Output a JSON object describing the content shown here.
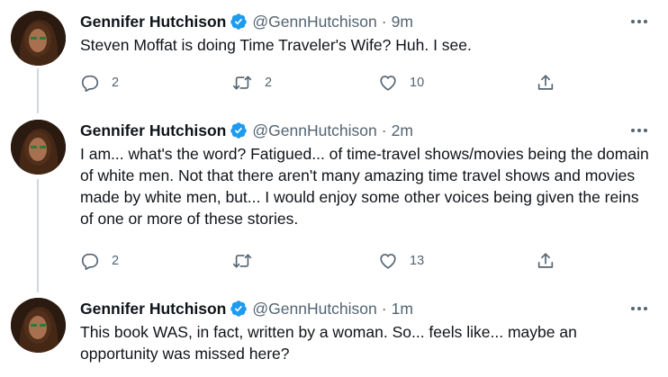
{
  "tweets": [
    {
      "name": "Gennifer Hutchison",
      "handle": "@GennHutchison",
      "separator": "·",
      "time": "9m",
      "text": "Steven Moffat is doing Time Traveler's Wife? Huh. I see.",
      "replies": "2",
      "retweets": "2",
      "likes": "10"
    },
    {
      "name": "Gennifer Hutchison",
      "handle": "@GennHutchison",
      "separator": "·",
      "time": "2m",
      "text": "I am... what's the word? Fatigued... of time-travel shows/movies being the domain of white men. Not that there aren't many amazing time travel shows and movies made by white men, but... I would enjoy some other voices being given the reins of one or more of these stories.",
      "replies": "2",
      "retweets": "",
      "likes": "13"
    },
    {
      "name": "Gennifer Hutchison",
      "handle": "@GennHutchison",
      "separator": "·",
      "time": "1m",
      "text": "This book WAS, in fact, written by a woman. So... feels like... maybe an opportunity was missed here?"
    }
  ],
  "icons": {
    "verified": "verified-badge-icon",
    "more": "more-options-icon",
    "reply": "reply-icon",
    "retweet": "retweet-icon",
    "like": "like-icon",
    "share": "share-icon"
  },
  "colors": {
    "verified": "#1d9bf0",
    "secondary_text": "#536471",
    "thread_line": "#cfd9de"
  }
}
